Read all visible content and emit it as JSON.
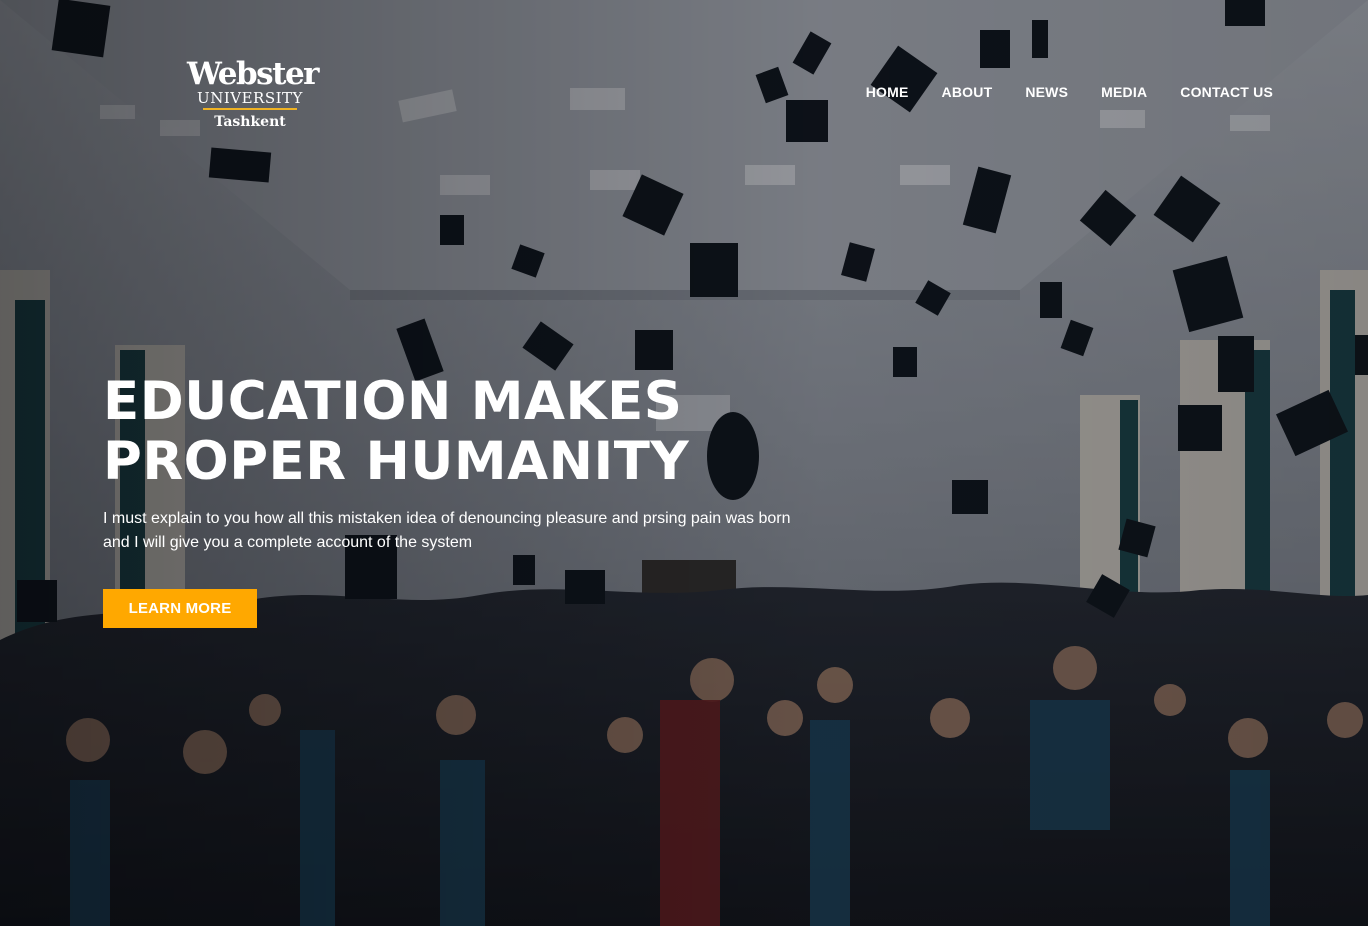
{
  "logo": {
    "brand": "Webster",
    "university": "UNIVERSITY",
    "city": "Tashkent",
    "accent_color": "#f0b323"
  },
  "nav": {
    "items": [
      {
        "label": "HOME"
      },
      {
        "label": "ABOUT"
      },
      {
        "label": "NEWS"
      },
      {
        "label": "MEDIA"
      },
      {
        "label": "CONTACT US"
      }
    ]
  },
  "hero": {
    "headline_line1": "EDUCATION MAKES",
    "headline_line2": "PROPER HUMANITY",
    "subtitle": "I must explain to you how all this mistaken idea of denouncing pleasure and prsing pain was born and I will give you a complete account of the system",
    "cta_label": "LEARN MORE",
    "cta_color": "#ffa800",
    "background_image": "graduation-ceremony-caps-thrown-photo"
  }
}
